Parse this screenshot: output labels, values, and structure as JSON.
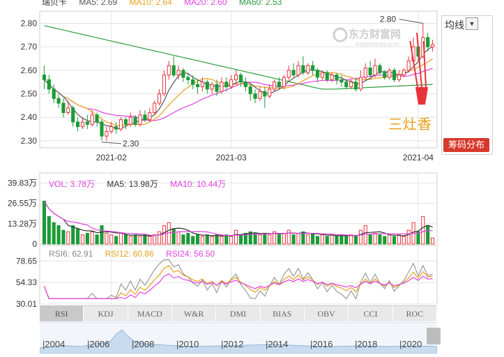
{
  "stock_name_partial": "瑞贝卡",
  "price_legend": {
    "ma5": "MA5: 2.69",
    "ma10": "MA10: 2.64",
    "ma20": "MA20: 2.60",
    "ma60": "MA60: 2.53"
  },
  "volume_legend": {
    "vol": "VOL: 3.78万",
    "ma5": "MA5: 13.98万",
    "ma10": "MA10: 10.44万"
  },
  "rsi_legend": {
    "rsi6": "RSI6: 62.91",
    "rsi12": "RSI12: 60.86",
    "rsi24": "RSI24: 56.50"
  },
  "colors": {
    "up": "#e8333a",
    "down": "#1a9b36",
    "ma5": "#555555",
    "ma10": "#e6a020",
    "ma20": "#e040e0",
    "ma60": "#2a9a3a",
    "grid": "#e3e3e3"
  },
  "watermark": "东方财富网 eastmoney.com",
  "annotation_sanzao": "三灶香",
  "side": {
    "avg_label": "均线",
    "chip_button": "筹码分布"
  },
  "price_annotations": {
    "high": "2.80",
    "low": "2.30"
  },
  "indicator_tabs": [
    "RSI",
    "KDJ",
    "MACD",
    "W&R",
    "DMI",
    "BIAS",
    "OBV",
    "CCI",
    "ROC"
  ],
  "timeline_years": [
    "2004",
    "2006",
    "2008",
    "2010",
    "2012",
    "2014",
    "2016",
    "2018",
    "2020"
  ],
  "chart_data": [
    {
      "type": "candlestick",
      "title": "",
      "y_ticks": [
        "2.80",
        "2.70",
        "2.60",
        "2.50",
        "2.40",
        "2.30"
      ],
      "ylim": [
        2.27,
        2.84
      ],
      "x_ticks": [
        "2021-02",
        "2021-03",
        "2021-04"
      ],
      "x_tick_index": [
        14,
        39,
        78
      ],
      "candles": [
        [
          2.58,
          2.56,
          2.62,
          2.52
        ],
        [
          2.56,
          2.52,
          2.58,
          2.5
        ],
        [
          2.52,
          2.48,
          2.54,
          2.46
        ],
        [
          2.48,
          2.46,
          2.5,
          2.44
        ],
        [
          2.46,
          2.42,
          2.48,
          2.4
        ],
        [
          2.42,
          2.44,
          2.47,
          2.41
        ],
        [
          2.44,
          2.38,
          2.45,
          2.36
        ],
        [
          2.38,
          2.36,
          2.4,
          2.34
        ],
        [
          2.36,
          2.38,
          2.4,
          2.35
        ],
        [
          2.38,
          2.37,
          2.41,
          2.35
        ],
        [
          2.37,
          2.41,
          2.43,
          2.36
        ],
        [
          2.41,
          2.38,
          2.42,
          2.36
        ],
        [
          2.38,
          2.32,
          2.39,
          2.3
        ],
        [
          2.32,
          2.34,
          2.36,
          2.3
        ],
        [
          2.34,
          2.36,
          2.38,
          2.33
        ],
        [
          2.36,
          2.35,
          2.38,
          2.33
        ],
        [
          2.35,
          2.39,
          2.4,
          2.34
        ],
        [
          2.39,
          2.37,
          2.4,
          2.35
        ],
        [
          2.37,
          2.4,
          2.42,
          2.36
        ],
        [
          2.4,
          2.37,
          2.41,
          2.36
        ],
        [
          2.37,
          2.41,
          2.43,
          2.36
        ],
        [
          2.41,
          2.39,
          2.43,
          2.38
        ],
        [
          2.39,
          2.42,
          2.44,
          2.38
        ],
        [
          2.42,
          2.46,
          2.47,
          2.41
        ],
        [
          2.46,
          2.5,
          2.52,
          2.45
        ],
        [
          2.5,
          2.58,
          2.6,
          2.49
        ],
        [
          2.58,
          2.62,
          2.64,
          2.56
        ],
        [
          2.62,
          2.58,
          2.66,
          2.57
        ],
        [
          2.58,
          2.6,
          2.62,
          2.56
        ],
        [
          2.6,
          2.57,
          2.61,
          2.55
        ],
        [
          2.57,
          2.56,
          2.59,
          2.54
        ],
        [
          2.56,
          2.54,
          2.58,
          2.52
        ],
        [
          2.54,
          2.53,
          2.56,
          2.5
        ],
        [
          2.53,
          2.55,
          2.57,
          2.51
        ],
        [
          2.55,
          2.52,
          2.56,
          2.5
        ],
        [
          2.52,
          2.54,
          2.55,
          2.5
        ],
        [
          2.54,
          2.51,
          2.56,
          2.49
        ],
        [
          2.51,
          2.55,
          2.57,
          2.5
        ],
        [
          2.55,
          2.53,
          2.57,
          2.51
        ],
        [
          2.53,
          2.56,
          2.58,
          2.52
        ],
        [
          2.56,
          2.58,
          2.6,
          2.54
        ],
        [
          2.58,
          2.55,
          2.59,
          2.53
        ],
        [
          2.55,
          2.53,
          2.57,
          2.51
        ],
        [
          2.53,
          2.5,
          2.54,
          2.47
        ],
        [
          2.5,
          2.48,
          2.52,
          2.46
        ],
        [
          2.48,
          2.51,
          2.53,
          2.47
        ],
        [
          2.51,
          2.49,
          2.53,
          2.44
        ],
        [
          2.49,
          2.52,
          2.54,
          2.48
        ],
        [
          2.52,
          2.55,
          2.56,
          2.51
        ],
        [
          2.55,
          2.53,
          2.57,
          2.52
        ],
        [
          2.53,
          2.57,
          2.58,
          2.52
        ],
        [
          2.57,
          2.6,
          2.62,
          2.56
        ],
        [
          2.6,
          2.58,
          2.63,
          2.57
        ],
        [
          2.58,
          2.62,
          2.64,
          2.57
        ],
        [
          2.62,
          2.59,
          2.66,
          2.58
        ],
        [
          2.59,
          2.62,
          2.63,
          2.58
        ],
        [
          2.62,
          2.6,
          2.64,
          2.58
        ],
        [
          2.6,
          2.57,
          2.61,
          2.55
        ],
        [
          2.57,
          2.59,
          2.6,
          2.56
        ],
        [
          2.59,
          2.56,
          2.6,
          2.55
        ],
        [
          2.56,
          2.58,
          2.59,
          2.55
        ],
        [
          2.58,
          2.56,
          2.59,
          2.54
        ],
        [
          2.56,
          2.55,
          2.58,
          2.53
        ],
        [
          2.55,
          2.53,
          2.56,
          2.52
        ],
        [
          2.53,
          2.55,
          2.56,
          2.52
        ],
        [
          2.55,
          2.52,
          2.57,
          2.51
        ],
        [
          2.52,
          2.57,
          2.6,
          2.51
        ],
        [
          2.57,
          2.61,
          2.63,
          2.56
        ],
        [
          2.61,
          2.58,
          2.64,
          2.57
        ],
        [
          2.58,
          2.62,
          2.65,
          2.57
        ],
        [
          2.62,
          2.59,
          2.63,
          2.58
        ],
        [
          2.59,
          2.57,
          2.6,
          2.56
        ],
        [
          2.57,
          2.6,
          2.61,
          2.56
        ],
        [
          2.6,
          2.56,
          2.61,
          2.55
        ],
        [
          2.56,
          2.58,
          2.6,
          2.55
        ],
        [
          2.58,
          2.6,
          2.61,
          2.57
        ],
        [
          2.6,
          2.64,
          2.66,
          2.59
        ],
        [
          2.64,
          2.7,
          2.74,
          2.63
        ],
        [
          2.7,
          2.66,
          2.72,
          2.64
        ],
        [
          2.66,
          2.74,
          2.8,
          2.65
        ],
        [
          2.74,
          2.7,
          2.76,
          2.68
        ],
        [
          2.7,
          2.71,
          2.73,
          2.68
        ]
      ],
      "volume": {
        "y_ticks": [
          "39.83万",
          "26.55万",
          "13.28万",
          "0"
        ],
        "ylim": [
          0,
          40
        ],
        "values": [
          28,
          18,
          14,
          12,
          9,
          8,
          12,
          10,
          6,
          7,
          8,
          6,
          12,
          7,
          6,
          5,
          7,
          6,
          5,
          6,
          5,
          6,
          5,
          6,
          8,
          12,
          14,
          10,
          8,
          6,
          7,
          5,
          6,
          5,
          6,
          5,
          6,
          5,
          6,
          5,
          9,
          6,
          7,
          8,
          7,
          6,
          7,
          6,
          8,
          6,
          7,
          9,
          6,
          7,
          8,
          6,
          7,
          5,
          6,
          5,
          6,
          5,
          6,
          5,
          6,
          5,
          9,
          12,
          6,
          7,
          6,
          5,
          6,
          5,
          6,
          5,
          9,
          14,
          8,
          18,
          12,
          4
        ]
      },
      "rsi": {
        "y_ticks": [
          "78.65",
          "54.33",
          "30.01"
        ],
        "ylim": [
          30,
          82
        ]
      }
    }
  ]
}
